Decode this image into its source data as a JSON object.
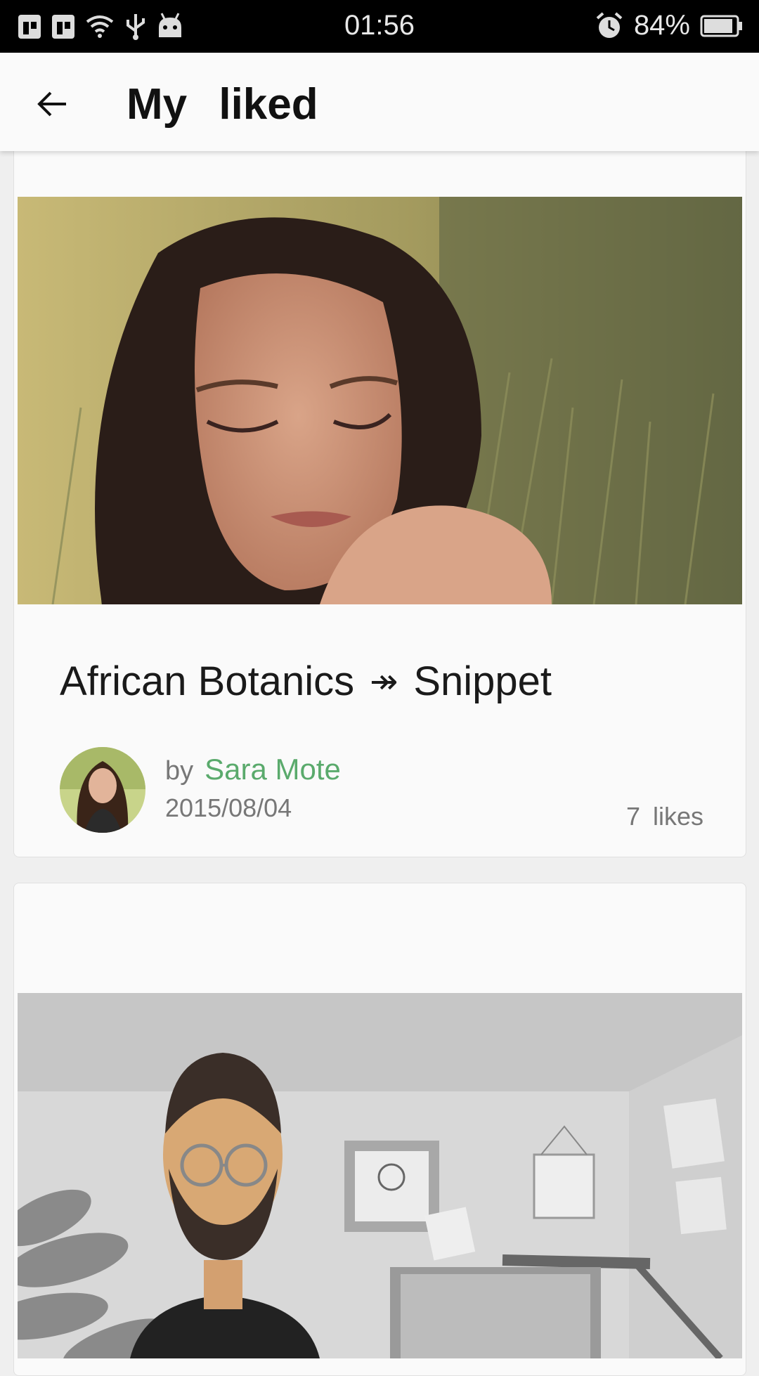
{
  "status_bar": {
    "time": "01:56",
    "battery": "84%",
    "icons_left": [
      "sim1-icon",
      "sim2-icon",
      "wifi-icon",
      "usb-icon",
      "android-icon"
    ],
    "icons_right": [
      "alarm-icon",
      "battery-icon"
    ]
  },
  "app_bar": {
    "title": "My liked",
    "back_icon": "arrow-left-icon"
  },
  "cards": [
    {
      "title": "African Botanics",
      "arrow": "↠",
      "subtitle": "Snippet",
      "by_label": "by",
      "author": "Sara Mote",
      "date": "2015/08/04",
      "likes": "7 likes"
    }
  ],
  "colors": {
    "author": "#5aaa6c",
    "status_bar_bg": "#000000",
    "app_bar_bg": "#fafafa"
  }
}
